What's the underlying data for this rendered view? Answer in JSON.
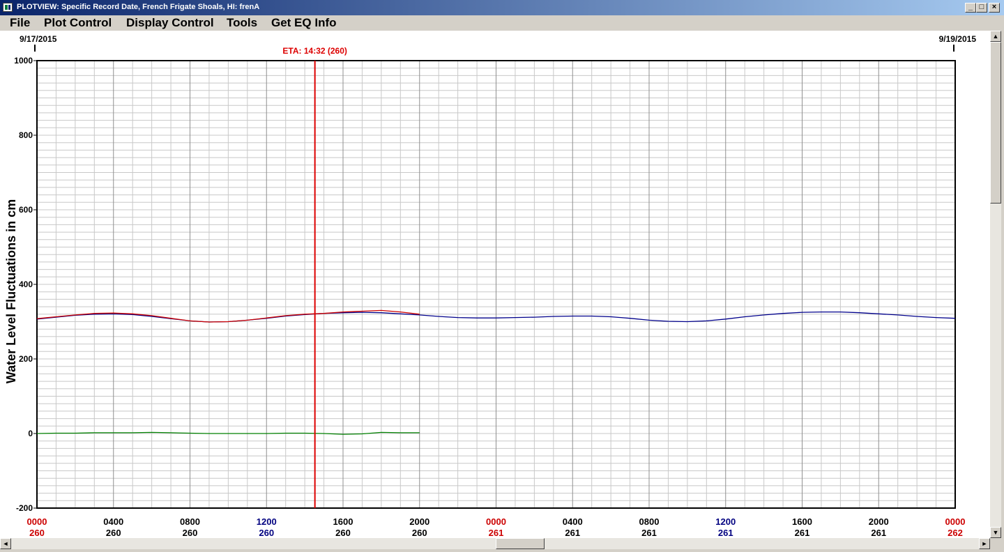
{
  "window": {
    "title": "PLOTVIEW: Specific Record Date, French Frigate Shoals, HI: frenA",
    "minimize_glyph": "_",
    "maximize_glyph": "□",
    "close_glyph": "×"
  },
  "menu": [
    "File",
    "Plot Control",
    "Display Control",
    "Tools",
    "Get EQ Info"
  ],
  "scrollbars": {
    "up": "▲",
    "down": "▼",
    "left": "◄",
    "right": "►"
  },
  "colors": {
    "observed": "#cc0000",
    "predicted": "#00008b",
    "residual": "#008000",
    "eta_line": "#dd0000",
    "day_label": "#cc0000",
    "noon_label": "#000080"
  },
  "chart_data": {
    "type": "line",
    "ylabel": "Water Level Fluctuations in cm",
    "ylim": [
      -200,
      1000
    ],
    "yticks": [
      -200,
      0,
      200,
      400,
      600,
      800,
      1000
    ],
    "x_unit": "hours since 9/17/2015 0000",
    "xlim": [
      0,
      48
    ],
    "start_date": "9/17/2015",
    "end_date": "9/19/2015",
    "x_ticks": [
      {
        "x": 0,
        "time": "0000",
        "day": "260",
        "kind": "day"
      },
      {
        "x": 4,
        "time": "0400",
        "day": "260",
        "kind": "normal"
      },
      {
        "x": 8,
        "time": "0800",
        "day": "260",
        "kind": "normal"
      },
      {
        "x": 12,
        "time": "1200",
        "day": "260",
        "kind": "noon"
      },
      {
        "x": 16,
        "time": "1600",
        "day": "260",
        "kind": "normal"
      },
      {
        "x": 20,
        "time": "2000",
        "day": "260",
        "kind": "normal"
      },
      {
        "x": 24,
        "time": "0000",
        "day": "261",
        "kind": "day"
      },
      {
        "x": 28,
        "time": "0400",
        "day": "261",
        "kind": "normal"
      },
      {
        "x": 32,
        "time": "0800",
        "day": "261",
        "kind": "normal"
      },
      {
        "x": 36,
        "time": "1200",
        "day": "261",
        "kind": "noon"
      },
      {
        "x": 40,
        "time": "1600",
        "day": "261",
        "kind": "normal"
      },
      {
        "x": 44,
        "time": "2000",
        "day": "261",
        "kind": "normal"
      },
      {
        "x": 48,
        "time": "0000",
        "day": "262",
        "kind": "day"
      }
    ],
    "eta": {
      "label": "ETA: 14:32 (260)",
      "x": 14.53
    },
    "series": [
      {
        "color": "#cc0000",
        "x": [
          0,
          1,
          2,
          3,
          4,
          5,
          6,
          7,
          8,
          9,
          10,
          11,
          12,
          13,
          14,
          15,
          16,
          17,
          18,
          19,
          20
        ],
        "y": [
          308,
          313,
          318,
          322,
          323,
          321,
          316,
          309,
          302,
          299,
          300,
          304,
          310,
          316,
          320,
          322,
          326,
          328,
          330,
          326,
          320
        ]
      },
      {
        "color": "#00008b",
        "x": [
          0,
          1,
          2,
          3,
          4,
          5,
          6,
          7,
          8,
          9,
          10,
          11,
          12,
          13,
          14,
          15,
          16,
          17,
          18,
          19,
          20,
          21,
          22,
          23,
          24,
          25,
          26,
          27,
          28,
          29,
          30,
          31,
          32,
          33,
          34,
          35,
          36,
          37,
          38,
          39,
          40,
          41,
          42,
          43,
          44,
          45,
          46,
          47,
          48
        ],
        "y": [
          307,
          312,
          317,
          320,
          321,
          319,
          314,
          308,
          302,
          299,
          300,
          304,
          309,
          315,
          319,
          322,
          324,
          325,
          324,
          321,
          318,
          314,
          311,
          310,
          310,
          311,
          312,
          314,
          315,
          315,
          313,
          309,
          304,
          301,
          300,
          302,
          307,
          313,
          318,
          322,
          325,
          326,
          326,
          324,
          321,
          318,
          314,
          311,
          309
        ]
      },
      {
        "color": "#008000",
        "x": [
          0,
          1,
          2,
          3,
          4,
          5,
          6,
          7,
          8,
          9,
          10,
          11,
          12,
          13,
          14,
          15,
          16,
          17,
          18,
          19,
          20
        ],
        "y": [
          0,
          1,
          1,
          2,
          2,
          2,
          3,
          2,
          1,
          0,
          0,
          0,
          0,
          1,
          1,
          0,
          -2,
          -1,
          3,
          2,
          2
        ]
      }
    ]
  }
}
